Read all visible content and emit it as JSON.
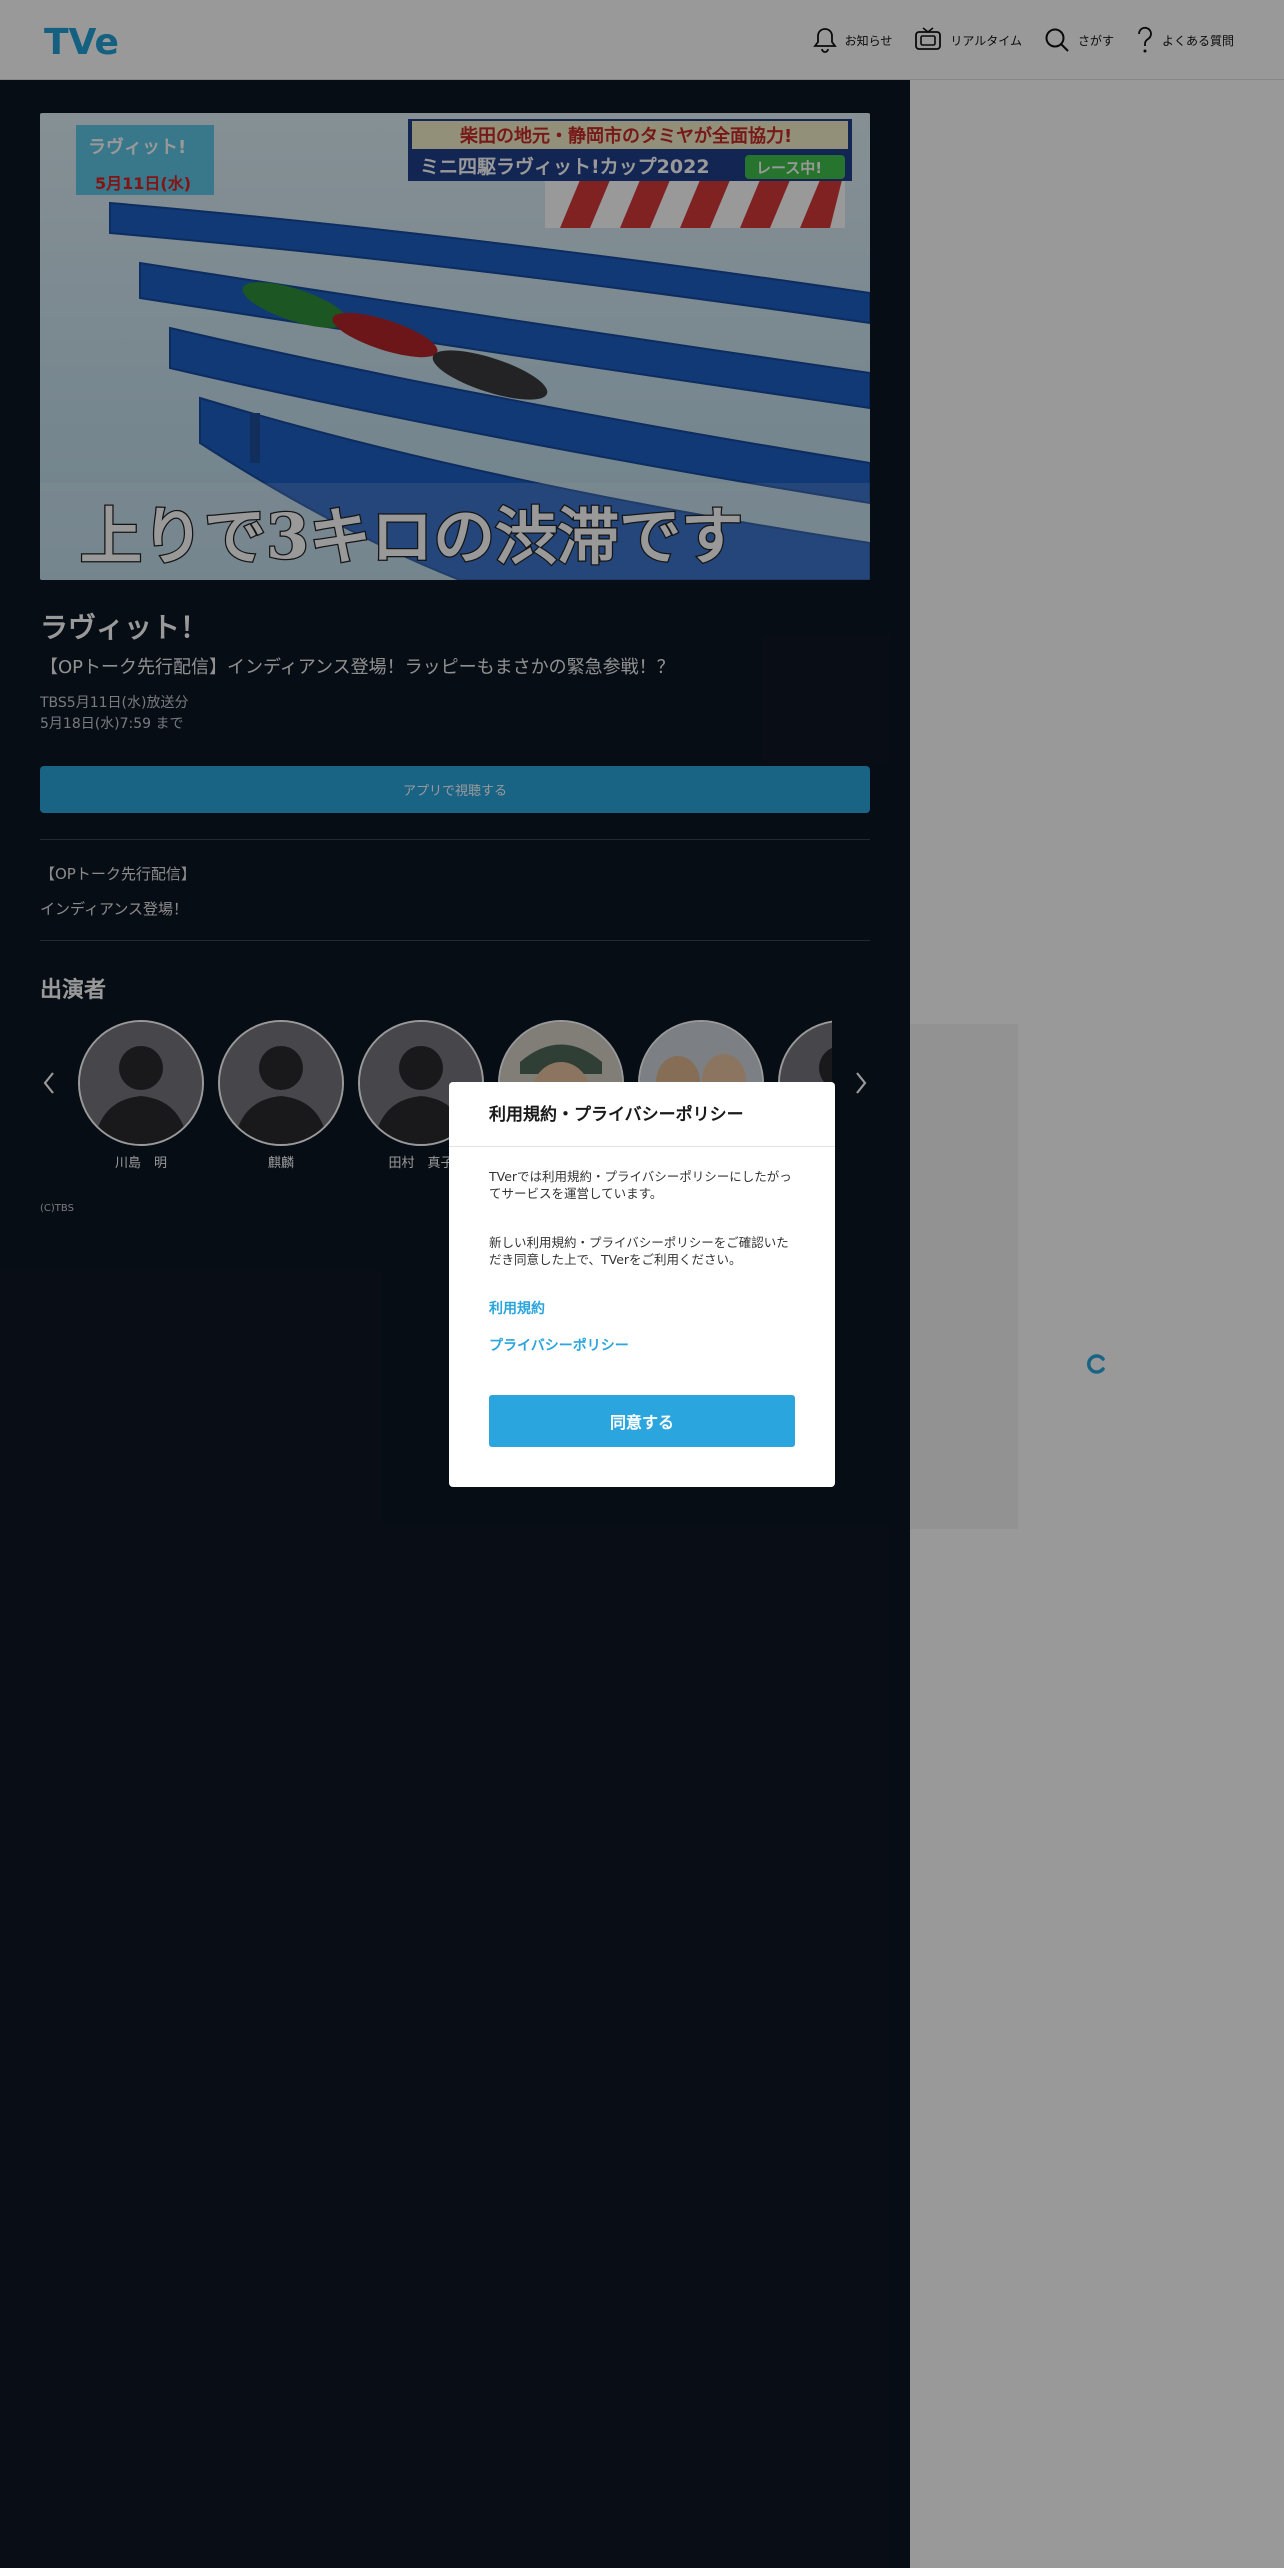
{
  "header": {
    "logo_text": "TVer",
    "nav": [
      {
        "label": "お知らせ",
        "icon": "bell-icon"
      },
      {
        "label": "リアルタイム",
        "icon": "tv-icon"
      },
      {
        "label": "さがす",
        "icon": "search-icon"
      },
      {
        "label": "よくある質問",
        "icon": "question-icon"
      }
    ]
  },
  "hero": {
    "badge_title": "ラヴィット!",
    "badge_date": "5月11日(水)",
    "banner_line1": "柴田の地元・静岡市のタミヤが全面協力!",
    "banner_line2": "ミニ四駆ラヴィット!カップ2022",
    "banner_tag": "レース中!",
    "caption": "上りで3キロの渋滞です"
  },
  "episode": {
    "title": "ラヴィット！",
    "subtitle": "【OPトーク先行配信】インディアンス登場！ラッピーもまさかの緊急参戦！？",
    "broadcast": "TBS5月11日(水)放送分",
    "expiry": "5月18日(水)7:59 まで",
    "app_button": "アプリで視聴する",
    "description": [
      "【OPトーク先行配信】",
      "インディアンス登場！"
    ]
  },
  "cast": {
    "heading": "出演者",
    "members": [
      {
        "name": "川島　明",
        "avatar": "placeholder"
      },
      {
        "name": "麒麟",
        "avatar": "placeholder"
      },
      {
        "name": "田村　真子",
        "avatar": "placeholder"
      },
      {
        "name": "",
        "avatar": "photo"
      },
      {
        "name": "",
        "avatar": "photo"
      },
      {
        "name": "",
        "avatar": "placeholder"
      }
    ]
  },
  "copyright": "(C)TBS",
  "modal": {
    "title": "利用規約・プライバシーポリシー",
    "text1": "TVerでは利用規約・プライバシーポリシーにしたがってサービスを運営しています。",
    "text2": "新しい利用規約・プライバシーポリシーをご確認いただき同意した上で、TVerをご利用ください。",
    "link_terms": "利用規約",
    "link_privacy": "プライバシーポリシー",
    "agree_button": "同意する"
  },
  "colors": {
    "accent": "#2aa5de",
    "background_dark": "#0d1624",
    "header": "#ffffff"
  }
}
